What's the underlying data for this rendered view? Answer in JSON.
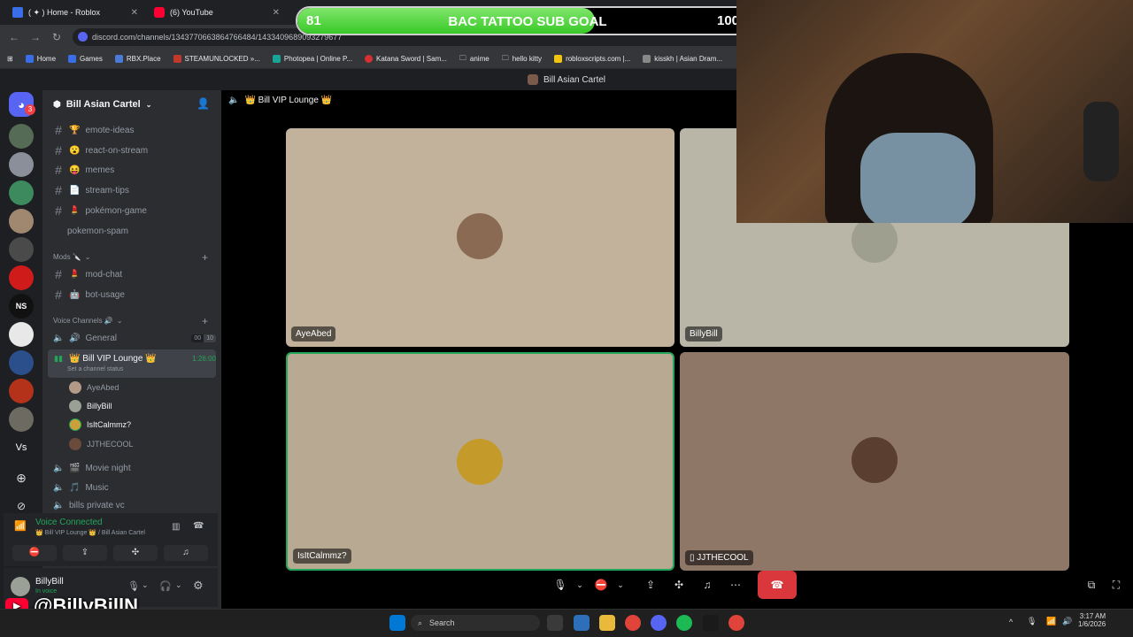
{
  "browser": {
    "tabs": [
      {
        "label": "( ✦ ) Home - Roblox"
      },
      {
        "label": "(6) YouTube"
      }
    ],
    "url": "discord.com/channels/1343770663864766484/1433409689093279677",
    "bookmarks": [
      "Home",
      "Games",
      "RBX.Place",
      "STEAMUNLOCKED »...",
      "Photopea | Online P...",
      "Katana Sword | Sam...",
      "anime",
      "hello kitty",
      "robloxscripts.com |...",
      "kisskh | Asian Dram..."
    ]
  },
  "goal": {
    "current": "81",
    "label": "BAC TATTOO SUB GOAL",
    "target": "100",
    "progress": 0.81
  },
  "discord": {
    "window_title": "Bill Asian Cartel",
    "notification_count": "3",
    "server_name": "Bill Asian Cartel",
    "text_channels": [
      {
        "emoji": "🏆",
        "name": "emote-ideas"
      },
      {
        "emoji": "😮",
        "name": "react-on-stream"
      },
      {
        "emoji": "😝",
        "name": "memes"
      },
      {
        "emoji": "📄",
        "name": "stream-tips"
      },
      {
        "emoji": "💄",
        "name": "pokémon-game"
      },
      {
        "emoji": "",
        "name": "pokemon-spam"
      }
    ],
    "mods_category": "Mods 🔪",
    "mod_channels": [
      {
        "emoji": "💄",
        "name": "mod-chat"
      },
      {
        "emoji": "🤖",
        "name": "bot-usage"
      }
    ],
    "voice_category": "Voice Channels 🔊",
    "voice_general": {
      "name": "General",
      "emoji": "🔊",
      "user_count": "00",
      "limit": "10"
    },
    "voice_active": {
      "name": "👑 Bill VIP Lounge 👑",
      "timer": "1:26:00",
      "status": "Set a channel status"
    },
    "voice_members": [
      "AyeAbed",
      "BillyBill",
      "IsItCalmmz?",
      "JJTHECOOL"
    ],
    "voice_other": [
      {
        "emoji": "🎬",
        "name": "Movie night"
      },
      {
        "emoji": "🎵",
        "name": "Music"
      },
      {
        "emoji": "",
        "name": "bills private vc"
      }
    ],
    "voice_connected": {
      "title": "Voice Connected",
      "subtitle": "👑 Bill VIP Lounge 👑 / Bill Asian Cartel"
    },
    "user": {
      "name": "BillyBill",
      "status": "In voice"
    },
    "call_header": "👑 Bill VIP Lounge 👑",
    "tiles": [
      {
        "name": "AyeAbed"
      },
      {
        "name": "BillyBill"
      },
      {
        "name": "IsItCalmmz?"
      },
      {
        "name": "JJTHECOOL"
      }
    ]
  },
  "watermark": "@BillyBillN",
  "taskbar": {
    "search": "Search",
    "time": "3:17 AM",
    "date": "1/6/2026"
  },
  "colors": {
    "goal_green": "#39c928",
    "discord_bg": "#2b2d31",
    "voice_green": "#23a55a",
    "hangup_red": "#da373c"
  }
}
